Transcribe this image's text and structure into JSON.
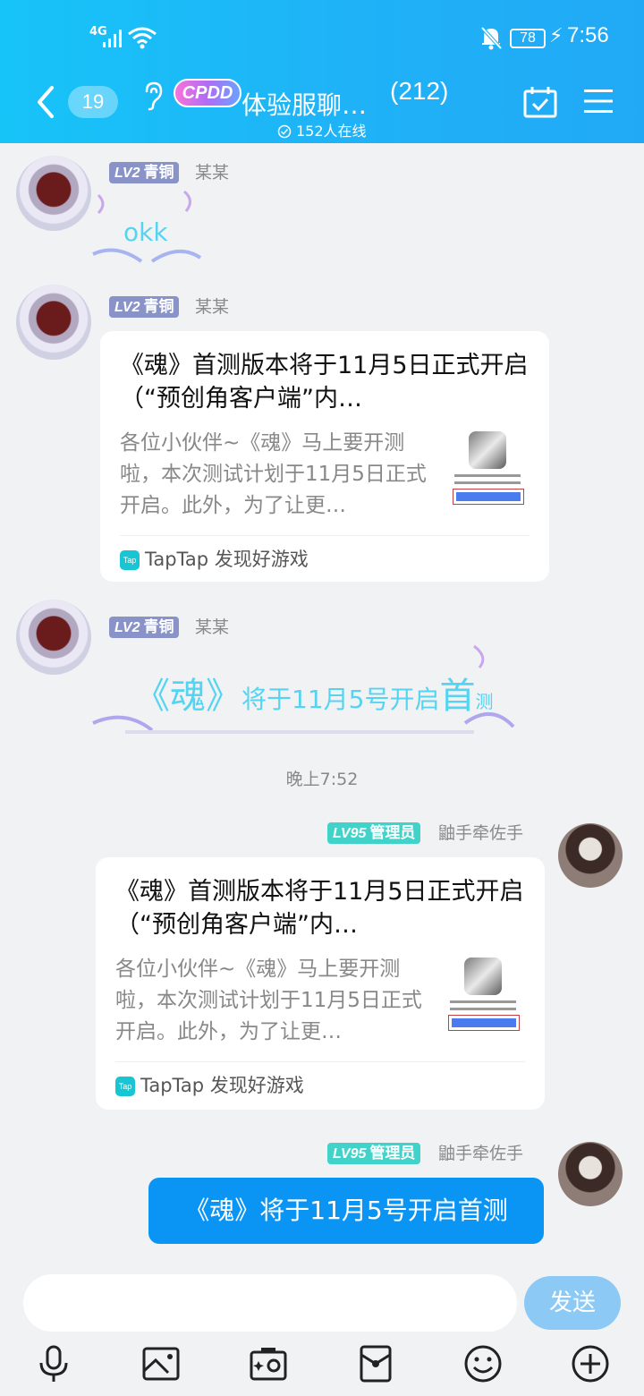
{
  "status_bar": {
    "signal": "4G",
    "battery": "78",
    "time": "7:56"
  },
  "header": {
    "unread_count": "19",
    "logo_text": "CPDD",
    "title": "体验服聊…",
    "member_count": "(212)",
    "online": "152人在线"
  },
  "messages": [
    {
      "level_badge": "LV2",
      "rank": "青铜",
      "sender": "某某",
      "type": "text",
      "text": "okk"
    },
    {
      "level_badge": "LV2",
      "rank": "青铜",
      "sender": "某某",
      "type": "card",
      "card": {
        "title": "《魂》首测版本将于11月5日正式开启（“预创角客户端”内…",
        "description": "各位小伙伴~《魂》马上要开测啦，本次测试计划于11月5日正式开启。此外，为了让更…",
        "source_icon": "Tap",
        "source": "TapTap 发现好游戏"
      }
    },
    {
      "level_badge": "LV2",
      "rank": "青铜",
      "sender": "某某",
      "type": "styled",
      "parts": [
        "《魂》",
        "将于11月5号开启",
        "首",
        "测"
      ]
    }
  ],
  "timestamp": "晚上7:52",
  "admin_messages": [
    {
      "level_badge": "LV95",
      "role": "管理员",
      "sender": "鼬手牵佐手",
      "type": "card",
      "card": {
        "title": "《魂》首测版本将于11月5日正式开启（“预创角客户端”内…",
        "description": "各位小伙伴~《魂》马上要开测啦，本次测试计划于11月5日正式开启。此外，为了让更…",
        "source_icon": "Tap",
        "source": "TapTap 发现好游戏"
      }
    },
    {
      "level_badge": "LV95",
      "role": "管理员",
      "sender": "鼬手牵佐手",
      "type": "text",
      "text": "《魂》将于11月5号开启首测"
    }
  ],
  "composer": {
    "placeholder": "",
    "send_label": "发送"
  },
  "toolbar": [
    "mic-icon",
    "image-icon",
    "camera-icon",
    "red-packet-icon",
    "emoji-icon",
    "plus-icon"
  ],
  "colors": {
    "header": "#1fb2f7",
    "accent_blue": "#0a95f5",
    "admin_badge": "#41d3c9",
    "bronze_badge": "#8a93c8"
  }
}
